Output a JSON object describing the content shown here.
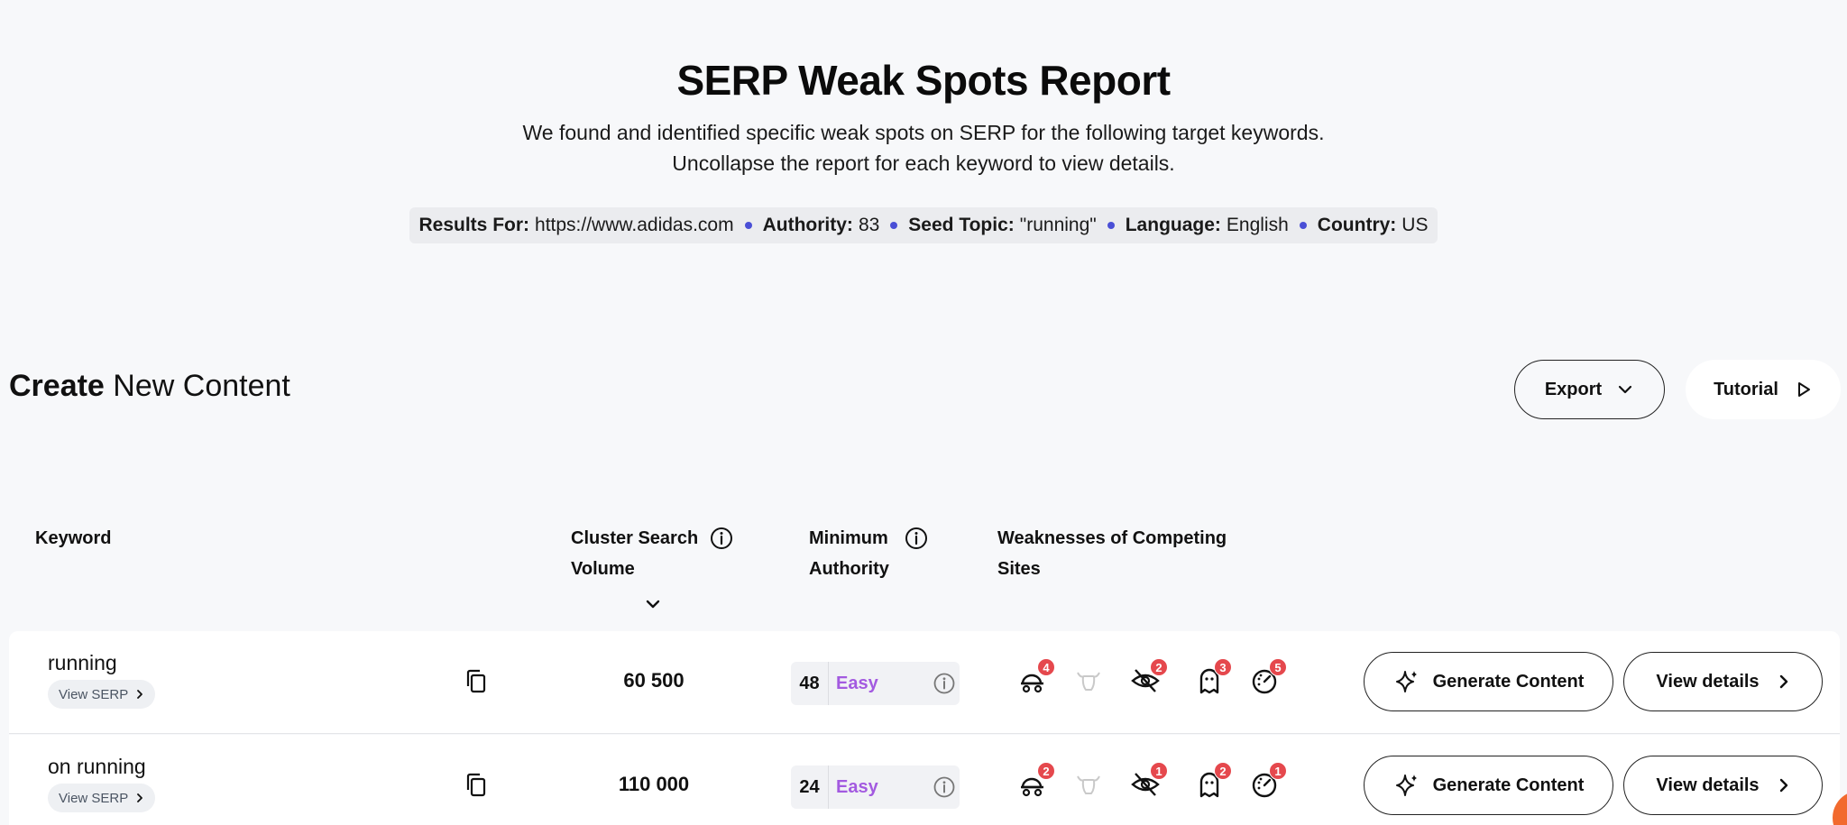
{
  "header": {
    "title": "SERP Weak Spots Report",
    "subtitle": "We found and identified specific weak spots on SERP for the following target keywords. Uncollapse the report for each keyword to view details."
  },
  "meta": {
    "results_label": "Results For:",
    "results_value": "https://www.adidas.com",
    "authority_label": "Authority:",
    "authority_value": "83",
    "seed_label": "Seed Topic:",
    "seed_value": "\"running\"",
    "language_label": "Language:",
    "language_value": "English",
    "country_label": "Country:",
    "country_value": "US"
  },
  "section": {
    "title_bold": "Create",
    "title_rest": "New Content"
  },
  "toolbar": {
    "export_label": "Export",
    "tutorial_label": "Tutorial"
  },
  "table": {
    "headers": {
      "keyword": "Keyword",
      "volume": "Cluster Search Volume",
      "authority": "Minimum Authority",
      "weaknesses": "Weaknesses of Competing Sites"
    },
    "rows": [
      {
        "keyword": "running",
        "view_serp": "View SERP",
        "volume": "60 500",
        "authority": "48",
        "difficulty": "Easy",
        "weaknesses": {
          "slow": "4",
          "cannot": "",
          "hidden": "2",
          "ghost": "3",
          "speed": "5"
        },
        "generate_label": "Generate Content",
        "details_label": "View details"
      },
      {
        "keyword": "on running",
        "view_serp": "View SERP",
        "volume": "110 000",
        "authority": "24",
        "difficulty": "Easy",
        "weaknesses": {
          "slow": "2",
          "cannot": "",
          "hidden": "1",
          "ghost": "2",
          "speed": "1"
        },
        "generate_label": "Generate Content",
        "details_label": "View details"
      }
    ]
  },
  "colors": {
    "accent_dot": "#4a4fd6",
    "easy": "#a35ae0",
    "badge": "#e5484d",
    "fab": "#f26a2e"
  }
}
